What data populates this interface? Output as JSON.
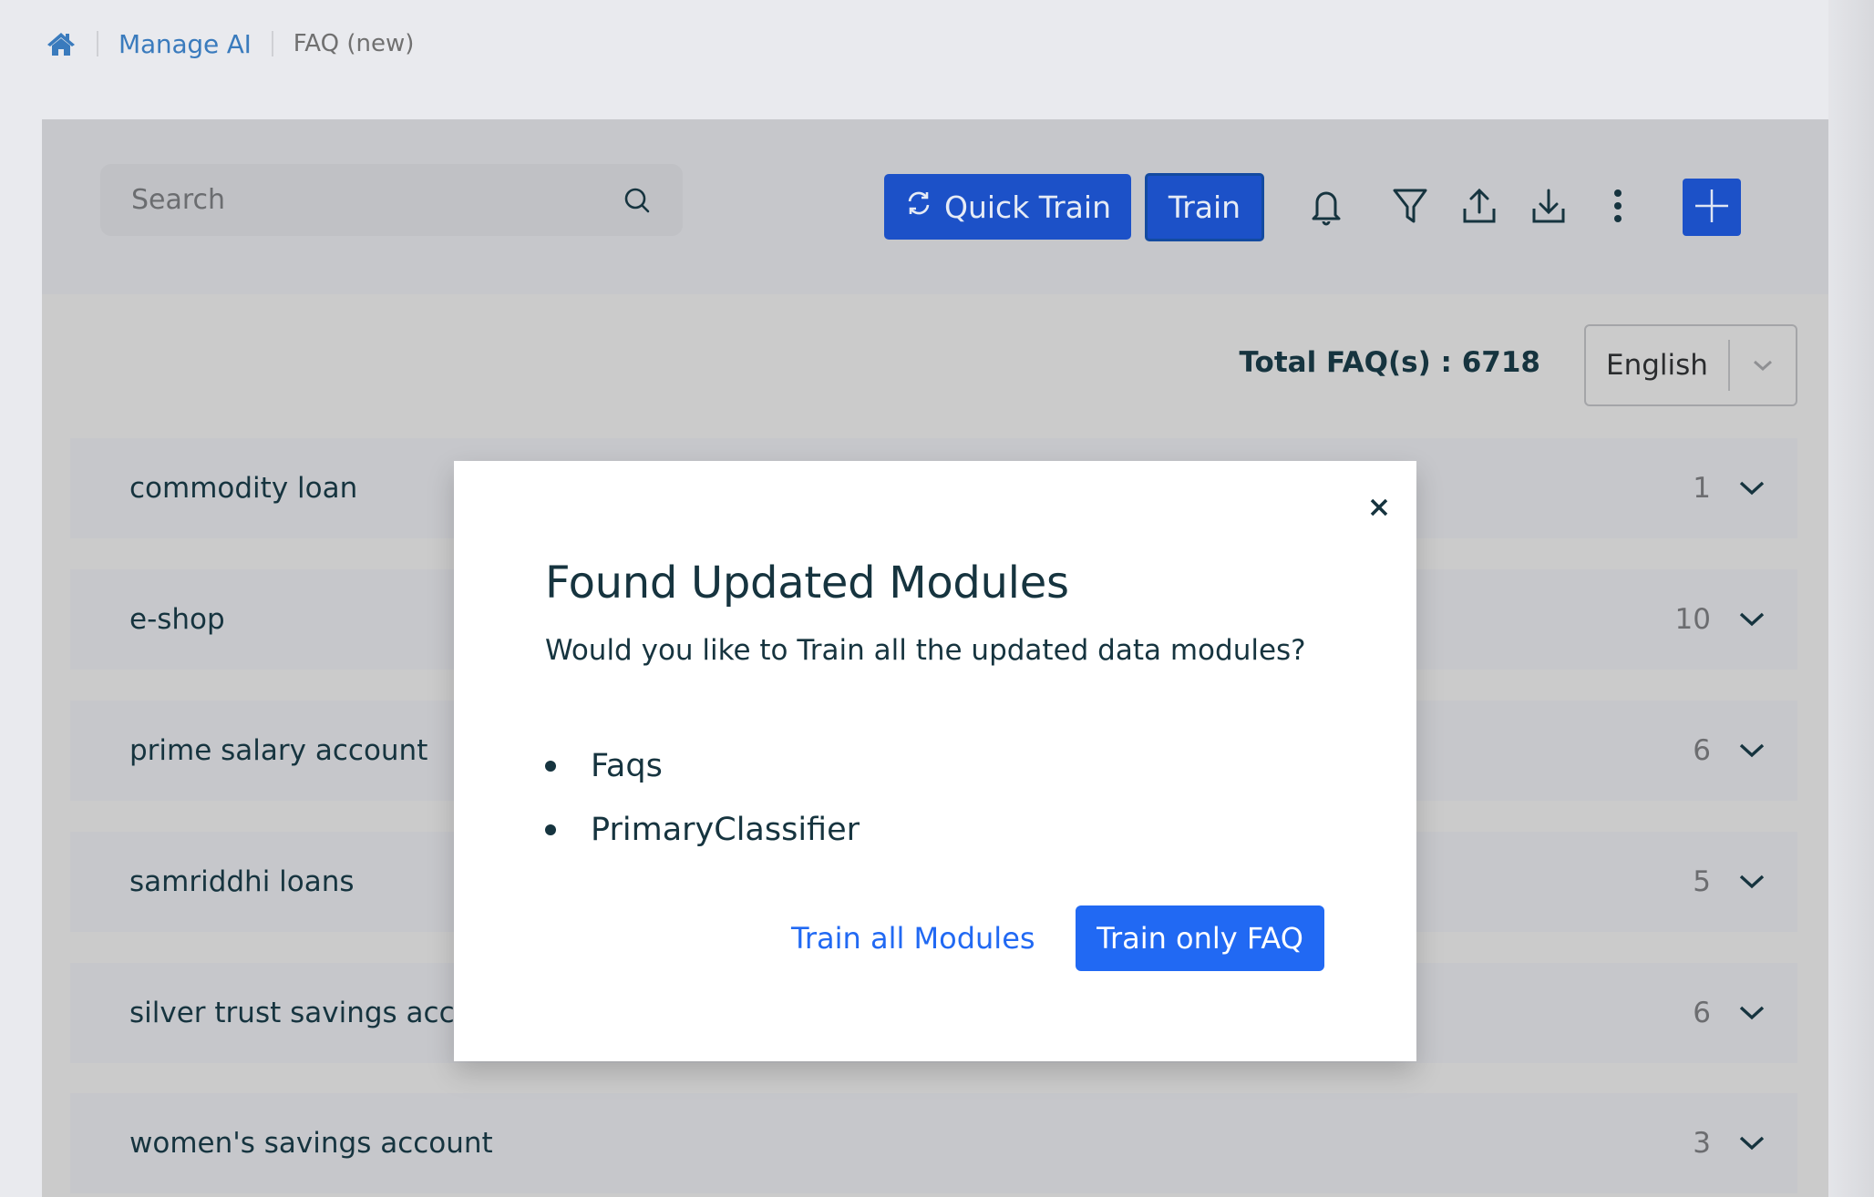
{
  "breadcrumb": {
    "home_icon": "home-icon",
    "items": [
      {
        "label": "Manage AI",
        "link": true
      },
      {
        "label": "FAQ (new)",
        "link": false
      }
    ]
  },
  "toolbar": {
    "search_placeholder": "Search",
    "search_value": "",
    "quick_train_label": "Quick Train",
    "train_label": "Train",
    "icons": [
      "sync-icon",
      "bell-icon",
      "filter-icon",
      "upload-icon",
      "download-icon",
      "kebab-menu-icon",
      "plus-icon"
    ],
    "accent": "#1c51c8"
  },
  "summary": {
    "total_label": "Total FAQ(s) : 6718",
    "language": "English"
  },
  "faq_groups": [
    {
      "title": "commodity loan",
      "count": "1"
    },
    {
      "title": "e-shop",
      "count": "10"
    },
    {
      "title": "prime salary account",
      "count": "6"
    },
    {
      "title": "samriddhi loans",
      "count": "5"
    },
    {
      "title": "silver trust savings account",
      "count": "6"
    },
    {
      "title": "women's savings account",
      "count": "3"
    }
  ],
  "modal": {
    "title": "Found Updated Modules",
    "subtitle": "Would you like to Train all the updated data modules?",
    "modules": [
      "Faqs",
      "PrimaryClassifier"
    ],
    "secondary_label": "Train all Modules",
    "primary_label": "Train only FAQ",
    "primary_color": "#2169f3"
  }
}
